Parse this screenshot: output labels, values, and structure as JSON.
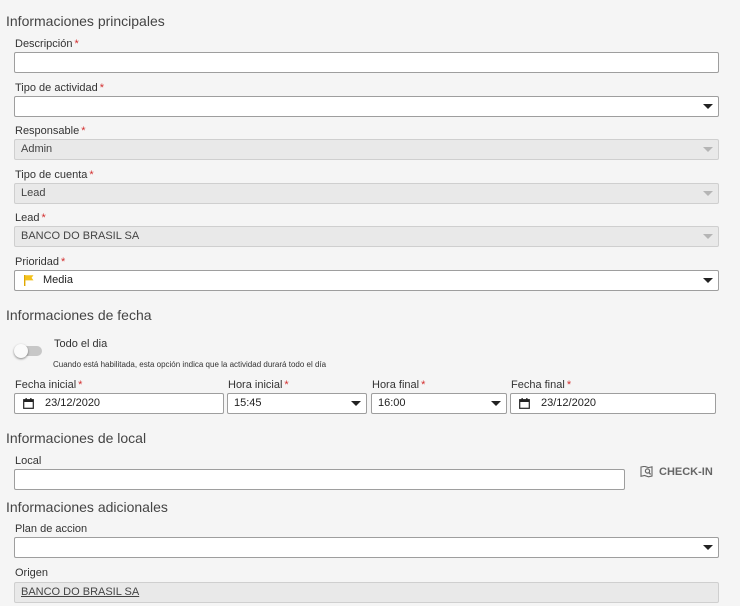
{
  "sections": {
    "main": "Informaciones principales",
    "date": "Informaciones de fecha",
    "local": "Informaciones de local",
    "extra": "Informaciones adicionales"
  },
  "required_mark": "*",
  "fields": {
    "descripcion": {
      "label": "Descripción",
      "value": ""
    },
    "tipo_actividad": {
      "label": "Tipo de actividad",
      "value": ""
    },
    "responsable": {
      "label": "Responsable",
      "value": "Admin"
    },
    "tipo_cuenta": {
      "label": "Tipo de cuenta",
      "value": "Lead"
    },
    "lead": {
      "label": "Lead",
      "value": "BANCO DO BRASIL SA"
    },
    "prioridad": {
      "label": "Prioridad",
      "value": "Media",
      "icon": "flag-icon",
      "icon_color": "#f4c21b"
    },
    "todo_dia": {
      "label": "Todo el dia",
      "helper": "Cuando está habilitada, esta opción indica que la actividad durará todo el día",
      "enabled": false
    },
    "fecha_inicial": {
      "label": "Fecha inicial",
      "value": "23/12/2020"
    },
    "hora_inicial": {
      "label": "Hora inicial",
      "value": "15:45"
    },
    "hora_final": {
      "label": "Hora final",
      "value": "16:00"
    },
    "fecha_final": {
      "label": "Fecha final",
      "value": "23/12/2020"
    },
    "local": {
      "label": "Local",
      "value": ""
    },
    "plan_accion": {
      "label": "Plan de accion",
      "value": ""
    },
    "origen": {
      "label": "Origen",
      "value": "BANCO DO BRASIL SA"
    }
  },
  "checkin": {
    "label": "CHECK-IN",
    "icon": "map-pin-icon"
  }
}
